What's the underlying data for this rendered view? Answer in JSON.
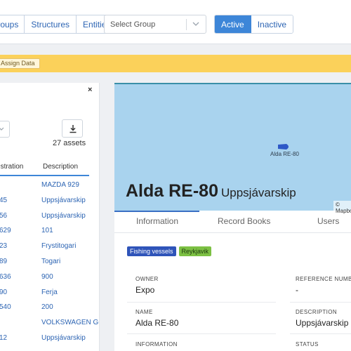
{
  "toolbar": {
    "nav_tabs": [
      "Groups",
      "Structures",
      "Entities"
    ],
    "group_select": {
      "placeholder": "Select Group"
    },
    "status_tabs": [
      {
        "label": "Active",
        "selected": true
      },
      {
        "label": "Inactive",
        "selected": false
      }
    ]
  },
  "banner": {
    "assign_label": "Assign Data"
  },
  "asset_list": {
    "close": "×",
    "asset_count": "27 assets",
    "columns": [
      "Registration",
      "Description"
    ],
    "rows": [
      {
        "reg": "",
        "desc": "MAZDA 929"
      },
      {
        "reg": "45",
        "desc": "Uppsjávarskip"
      },
      {
        "reg": "56",
        "desc": "Uppsjávarskip"
      },
      {
        "reg": "629",
        "desc": "101"
      },
      {
        "reg": "23",
        "desc": "Frystitogari"
      },
      {
        "reg": "89",
        "desc": "Togari"
      },
      {
        "reg": "636",
        "desc": "900"
      },
      {
        "reg": "90",
        "desc": "Ferja"
      },
      {
        "reg": "540",
        "desc": "200"
      },
      {
        "reg": "",
        "desc": "VOLKSWAGEN GOLF"
      },
      {
        "reg": "12",
        "desc": "Uppsjávarskip"
      }
    ]
  },
  "detail": {
    "map": {
      "vessel_label": "Alda RE-80",
      "attribution": "© Mapbox"
    },
    "name": "Alda RE-80",
    "type": "Uppsjávarskip",
    "tabs": [
      "Information",
      "Record Books",
      "Users"
    ],
    "tags": [
      "Fishing vessels",
      "Reykjavik"
    ],
    "fields": {
      "owner": {
        "label": "OWNER",
        "value": "Expo"
      },
      "reference": {
        "label": "REFERENCE NUMBER",
        "value": "-"
      },
      "name": {
        "label": "NAME",
        "value": "Alda RE-80"
      },
      "description": {
        "label": "DESCRIPTION",
        "value": "Uppsjávarskip"
      },
      "information": {
        "label": "INFORMATION",
        "value": ""
      },
      "status": {
        "label": "STATUS",
        "value": ""
      }
    }
  },
  "colors": {
    "accent": "#3d86d8",
    "banner": "#fbd15a",
    "map_water": "#a9d3ee",
    "tag_blue": "#2f54b9",
    "tag_green": "#7cc043"
  }
}
